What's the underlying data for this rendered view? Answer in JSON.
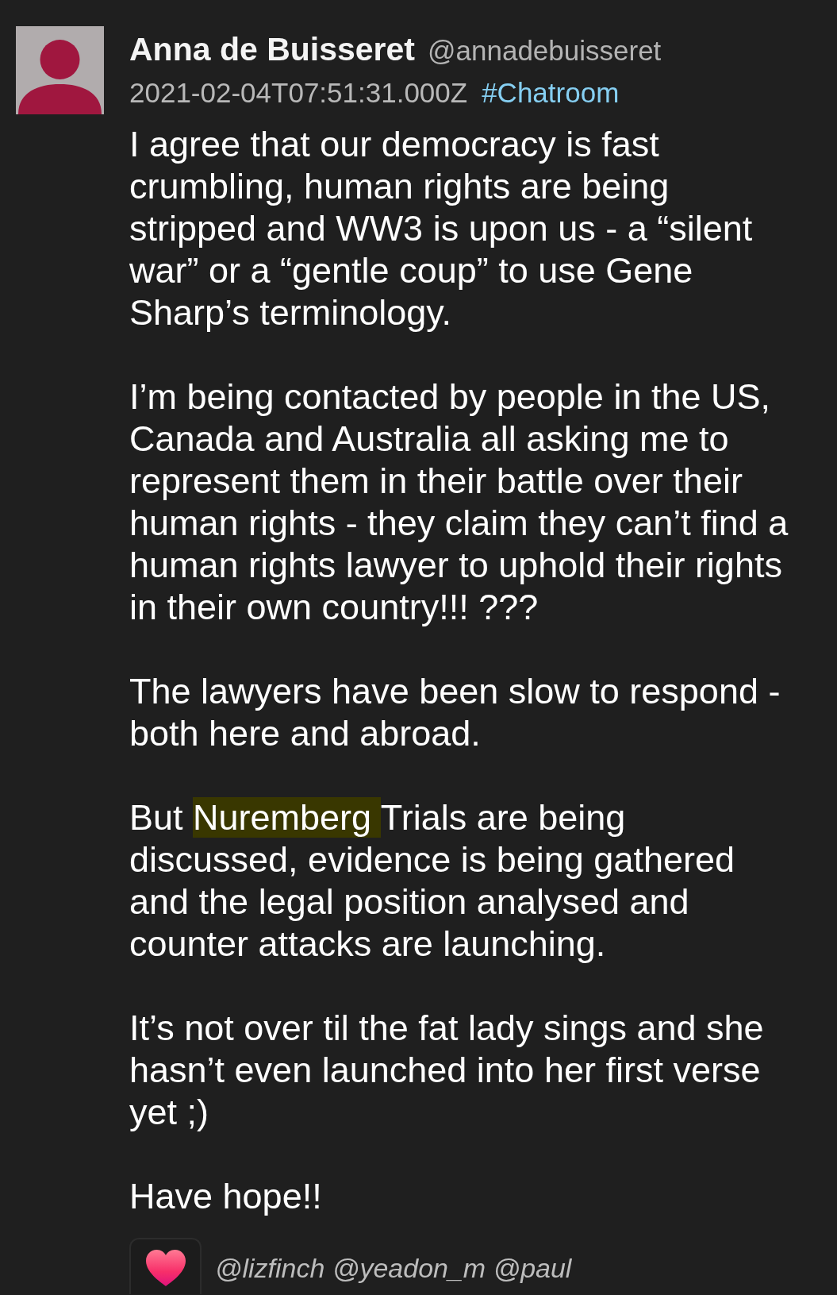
{
  "message": {
    "author": {
      "name": "Anna de Buisseret",
      "handle": "@annadebuisseret"
    },
    "timestamp": "2021-02-04T07:51:31.000Z",
    "channel": "#Chatroom",
    "paragraphs": [
      {
        "segments": [
          {
            "text": "I agree that our democracy is fast crumbling, human rights are being stripped and WW3 is upon us - a “silent war” or a “gentle coup” to use Gene Sharp’s terminology.",
            "highlighted": false
          }
        ]
      },
      {
        "segments": [
          {
            "text": "I’m being contacted by people in the US, Canada and Australia all asking me to represent them in their battle over their human rights - they claim they can’t find a human rights lawyer to uphold their rights in their own country!!! ???",
            "highlighted": false
          }
        ]
      },
      {
        "segments": [
          {
            "text": "The lawyers have been slow to respond - both here and abroad.",
            "highlighted": false
          }
        ]
      },
      {
        "segments": [
          {
            "text": "But ",
            "highlighted": false
          },
          {
            "text": "Nuremberg ",
            "highlighted": true
          },
          {
            "text": "Trials are being discussed, evidence is being gathered and the legal position analysed and counter attacks are launching.",
            "highlighted": false
          }
        ]
      },
      {
        "segments": [
          {
            "text": "It’s not over til the fat lady sings and she hasn’t even launched into her first verse yet ;)",
            "highlighted": false
          }
        ]
      },
      {
        "segments": [
          {
            "text": "Have hope!!",
            "highlighted": false
          }
        ]
      }
    ],
    "reaction": {
      "users": "@lizfinch @yeadon_m @paul"
    }
  }
}
